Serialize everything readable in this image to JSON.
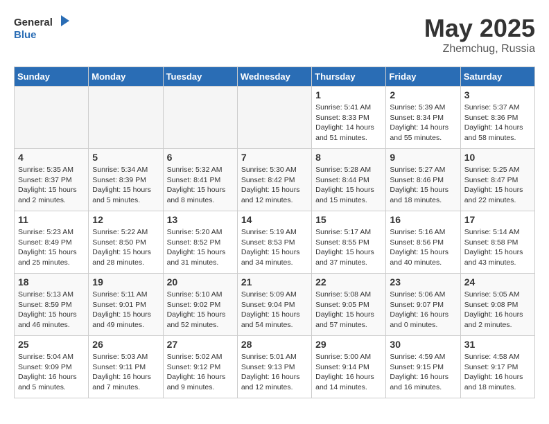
{
  "logo": {
    "general": "General",
    "blue": "Blue"
  },
  "title": "May 2025",
  "subtitle": "Zhemchug, Russia",
  "weekdays": [
    "Sunday",
    "Monday",
    "Tuesday",
    "Wednesday",
    "Thursday",
    "Friday",
    "Saturday"
  ],
  "weeks": [
    [
      {
        "day": "",
        "info": ""
      },
      {
        "day": "",
        "info": ""
      },
      {
        "day": "",
        "info": ""
      },
      {
        "day": "",
        "info": ""
      },
      {
        "day": "1",
        "info": "Sunrise: 5:41 AM\nSunset: 8:33 PM\nDaylight: 14 hours\nand 51 minutes."
      },
      {
        "day": "2",
        "info": "Sunrise: 5:39 AM\nSunset: 8:34 PM\nDaylight: 14 hours\nand 55 minutes."
      },
      {
        "day": "3",
        "info": "Sunrise: 5:37 AM\nSunset: 8:36 PM\nDaylight: 14 hours\nand 58 minutes."
      }
    ],
    [
      {
        "day": "4",
        "info": "Sunrise: 5:35 AM\nSunset: 8:37 PM\nDaylight: 15 hours\nand 2 minutes."
      },
      {
        "day": "5",
        "info": "Sunrise: 5:34 AM\nSunset: 8:39 PM\nDaylight: 15 hours\nand 5 minutes."
      },
      {
        "day": "6",
        "info": "Sunrise: 5:32 AM\nSunset: 8:41 PM\nDaylight: 15 hours\nand 8 minutes."
      },
      {
        "day": "7",
        "info": "Sunrise: 5:30 AM\nSunset: 8:42 PM\nDaylight: 15 hours\nand 12 minutes."
      },
      {
        "day": "8",
        "info": "Sunrise: 5:28 AM\nSunset: 8:44 PM\nDaylight: 15 hours\nand 15 minutes."
      },
      {
        "day": "9",
        "info": "Sunrise: 5:27 AM\nSunset: 8:46 PM\nDaylight: 15 hours\nand 18 minutes."
      },
      {
        "day": "10",
        "info": "Sunrise: 5:25 AM\nSunset: 8:47 PM\nDaylight: 15 hours\nand 22 minutes."
      }
    ],
    [
      {
        "day": "11",
        "info": "Sunrise: 5:23 AM\nSunset: 8:49 PM\nDaylight: 15 hours\nand 25 minutes."
      },
      {
        "day": "12",
        "info": "Sunrise: 5:22 AM\nSunset: 8:50 PM\nDaylight: 15 hours\nand 28 minutes."
      },
      {
        "day": "13",
        "info": "Sunrise: 5:20 AM\nSunset: 8:52 PM\nDaylight: 15 hours\nand 31 minutes."
      },
      {
        "day": "14",
        "info": "Sunrise: 5:19 AM\nSunset: 8:53 PM\nDaylight: 15 hours\nand 34 minutes."
      },
      {
        "day": "15",
        "info": "Sunrise: 5:17 AM\nSunset: 8:55 PM\nDaylight: 15 hours\nand 37 minutes."
      },
      {
        "day": "16",
        "info": "Sunrise: 5:16 AM\nSunset: 8:56 PM\nDaylight: 15 hours\nand 40 minutes."
      },
      {
        "day": "17",
        "info": "Sunrise: 5:14 AM\nSunset: 8:58 PM\nDaylight: 15 hours\nand 43 minutes."
      }
    ],
    [
      {
        "day": "18",
        "info": "Sunrise: 5:13 AM\nSunset: 8:59 PM\nDaylight: 15 hours\nand 46 minutes."
      },
      {
        "day": "19",
        "info": "Sunrise: 5:11 AM\nSunset: 9:01 PM\nDaylight: 15 hours\nand 49 minutes."
      },
      {
        "day": "20",
        "info": "Sunrise: 5:10 AM\nSunset: 9:02 PM\nDaylight: 15 hours\nand 52 minutes."
      },
      {
        "day": "21",
        "info": "Sunrise: 5:09 AM\nSunset: 9:04 PM\nDaylight: 15 hours\nand 54 minutes."
      },
      {
        "day": "22",
        "info": "Sunrise: 5:08 AM\nSunset: 9:05 PM\nDaylight: 15 hours\nand 57 minutes."
      },
      {
        "day": "23",
        "info": "Sunrise: 5:06 AM\nSunset: 9:07 PM\nDaylight: 16 hours\nand 0 minutes."
      },
      {
        "day": "24",
        "info": "Sunrise: 5:05 AM\nSunset: 9:08 PM\nDaylight: 16 hours\nand 2 minutes."
      }
    ],
    [
      {
        "day": "25",
        "info": "Sunrise: 5:04 AM\nSunset: 9:09 PM\nDaylight: 16 hours\nand 5 minutes."
      },
      {
        "day": "26",
        "info": "Sunrise: 5:03 AM\nSunset: 9:11 PM\nDaylight: 16 hours\nand 7 minutes."
      },
      {
        "day": "27",
        "info": "Sunrise: 5:02 AM\nSunset: 9:12 PM\nDaylight: 16 hours\nand 9 minutes."
      },
      {
        "day": "28",
        "info": "Sunrise: 5:01 AM\nSunset: 9:13 PM\nDaylight: 16 hours\nand 12 minutes."
      },
      {
        "day": "29",
        "info": "Sunrise: 5:00 AM\nSunset: 9:14 PM\nDaylight: 16 hours\nand 14 minutes."
      },
      {
        "day": "30",
        "info": "Sunrise: 4:59 AM\nSunset: 9:15 PM\nDaylight: 16 hours\nand 16 minutes."
      },
      {
        "day": "31",
        "info": "Sunrise: 4:58 AM\nSunset: 9:17 PM\nDaylight: 16 hours\nand 18 minutes."
      }
    ]
  ]
}
